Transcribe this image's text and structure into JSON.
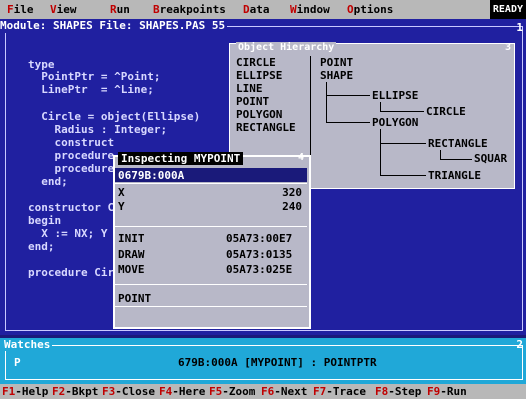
{
  "menu": {
    "items": [
      {
        "hotkey": "F",
        "rest": "ile"
      },
      {
        "hotkey": "V",
        "rest": "iew"
      },
      {
        "hotkey": "R",
        "rest": "un"
      },
      {
        "hotkey": "B",
        "rest": "reakpoints"
      },
      {
        "hotkey": "D",
        "rest": "ata"
      },
      {
        "hotkey": "W",
        "rest": "indow"
      },
      {
        "hotkey": "O",
        "rest": "ptions"
      }
    ],
    "status": "READY"
  },
  "module": {
    "title": "Module: SHAPES File: SHAPES.PAS 55",
    "number": "1",
    "code_lines": [
      "type",
      "  PointPtr = ^Point;",
      "  LinePtr  = ^Line;",
      "",
      "  Circle = object(Ellipse)",
      "    Radius : Integer;",
      "    construct",
      "    procedure",
      "    procedure",
      "  end;",
      "",
      "constructor C",
      "begin",
      "  X := NX; Y",
      "end;",
      "",
      "procedure Cir"
    ]
  },
  "hierarchy": {
    "title": "Object Hierarchy",
    "number": "3",
    "list": [
      "CIRCLE",
      "ELLIPSE",
      "LINE",
      "POINT",
      "POLYGON",
      "RECTANGLE"
    ],
    "tree": {
      "root1": "POINT",
      "root2": "SHAPE",
      "ellipse": "ELLIPSE",
      "circle": "CIRCLE",
      "polygon": "POLYGON",
      "rectangle": "RECTANGLE",
      "square": "SQUAR",
      "triangle": "TRIANGLE"
    }
  },
  "inspector": {
    "title": "Inspecting MYPOINT",
    "number": "4",
    "address": "0679B:000A",
    "fields": [
      {
        "name": "X",
        "value": "320"
      },
      {
        "name": "Y",
        "value": "240"
      }
    ],
    "methods": [
      {
        "name": "INIT",
        "addr": "05A73:00E7"
      },
      {
        "name": "DRAW",
        "addr": "05A73:0135"
      },
      {
        "name": "MOVE",
        "addr": "05A73:025E"
      }
    ],
    "type": "POINT"
  },
  "watches": {
    "title": "Watches",
    "number": "2",
    "var": "P",
    "value": "679B:000A [MYPOINT] : POINTPTR"
  },
  "statusbar": [
    {
      "key": "F1",
      "label": "-Help"
    },
    {
      "key": "F2",
      "label": "-Bkpt"
    },
    {
      "key": "F3",
      "label": "-Close"
    },
    {
      "key": "F4",
      "label": "-Here"
    },
    {
      "key": "F5",
      "label": "-Zoom"
    },
    {
      "key": "F6",
      "label": "-Next"
    },
    {
      "key": "F7",
      "label": "-Trace"
    },
    {
      "key": "F8",
      "label": "-Step"
    },
    {
      "key": "F9",
      "label": "-Run"
    }
  ],
  "colors": {
    "background": "#1a1a7a",
    "menubar": "#b8b8b8",
    "hotkey": "#c00000",
    "watches": "#20a8d8",
    "dialog": "#b8b8c8"
  }
}
